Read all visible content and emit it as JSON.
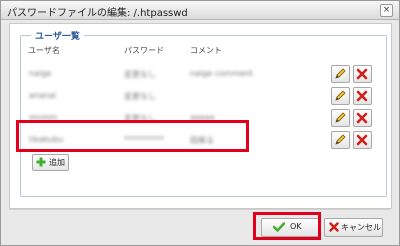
{
  "dialog": {
    "title": "パスワードファイルの編集: /.htpasswd",
    "close_glyph": "×"
  },
  "users": {
    "legend": "ユーザ一覧",
    "headers": {
      "user": "ユーザ名",
      "password": "パスワード",
      "comment": "コメント"
    },
    "rows": [
      {
        "user": "naige",
        "password": "変更なし",
        "comment": "naige comment"
      },
      {
        "user": "ananai",
        "password": "変更なし",
        "comment": ""
      },
      {
        "user": "mnmm",
        "password": "変更なし",
        "comment": "aaaaa"
      },
      {
        "user": "tikakubu",
        "password": "**********",
        "comment": "田尾る"
      }
    ],
    "add_label": "追加"
  },
  "footer": {
    "ok_label": "OK",
    "cancel_label": "キャンセル"
  },
  "colors": {
    "highlight": "#e0001b",
    "legend": "#2d5d9a",
    "ok_check": "#3fae2a",
    "delete_x": "#d0201a"
  }
}
